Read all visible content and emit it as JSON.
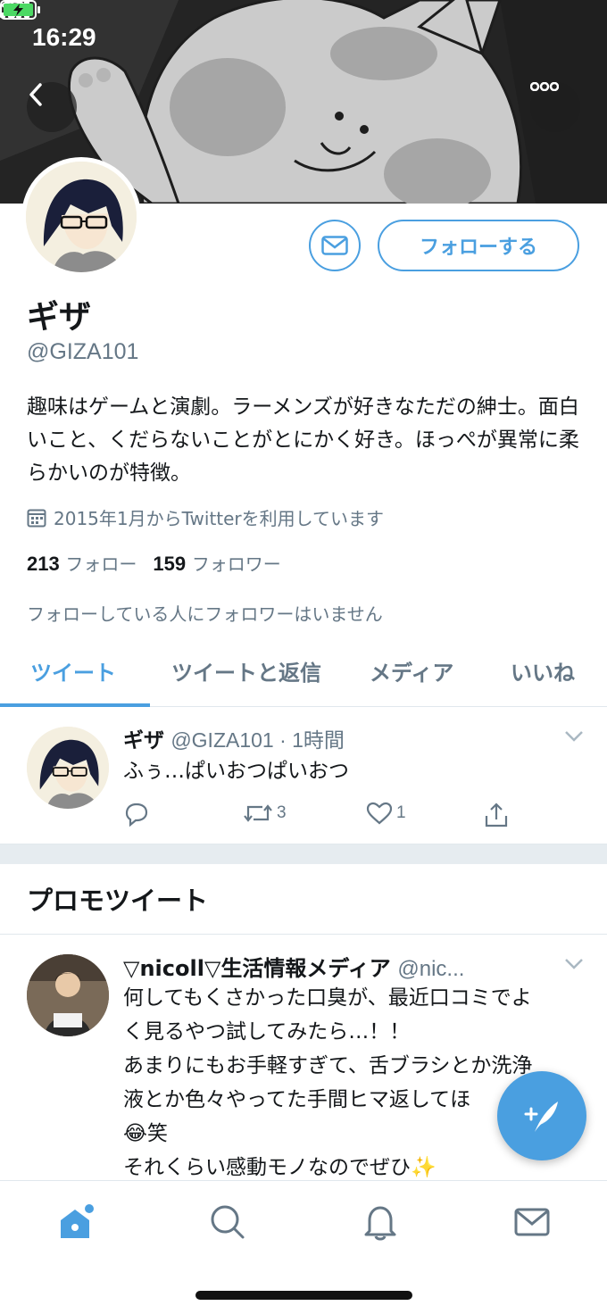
{
  "status_bar": {
    "time": "16:29"
  },
  "profile": {
    "name": "ギザ",
    "handle": "@GIZA101",
    "bio": "趣味はゲームと演劇。ラーメンズが好きなただの紳士。面白いこと、くだらないことがとにかく好き。ほっぺが異常に柔らかいのが特徴。",
    "joined": "2015年1月からTwitterを利用しています",
    "following_count": "213",
    "following_label": "フォロー",
    "followers_count": "159",
    "followers_label": "フォロワー",
    "followers_you_know": "フォローしている人にフォロワーはいません",
    "follow_button": "フォローする"
  },
  "tabs": [
    {
      "label": "ツイート",
      "active": true
    },
    {
      "label": "ツイートと返信",
      "active": false
    },
    {
      "label": "メディア",
      "active": false
    },
    {
      "label": "いいね",
      "active": false
    }
  ],
  "tweet": {
    "name": "ギザ",
    "meta": "@GIZA101 · 1時間",
    "text": "ふぅ…ぱいおつぱいおつ",
    "retweets": "3",
    "likes": "1"
  },
  "promo": {
    "section_title": "プロモツイート",
    "name": "▽nicoll▽生活情報メディア",
    "meta": "@nic...",
    "lines": [
      "何してもくさかった口臭が、最近口コミでよ",
      "く見るやつ試してみたら…！！",
      "あまりにもお手軽すぎて、舌ブラシとか洗浄",
      "液とか色々やってた手間ヒマ返してほ",
      "😂笑",
      "それくらい感動モノなのでぜひ✨"
    ]
  },
  "colors": {
    "accent": "#4a9fe0",
    "secondary_text": "#657786",
    "divider": "#e1e8ed"
  },
  "icons": [
    "back-arrow-icon",
    "more-icon",
    "mail-icon",
    "calendar-icon",
    "chevron-down-icon",
    "reply-icon",
    "retweet-icon",
    "like-icon",
    "share-icon",
    "compose-icon",
    "home-icon",
    "search-icon",
    "notifications-icon",
    "messages-icon"
  ]
}
